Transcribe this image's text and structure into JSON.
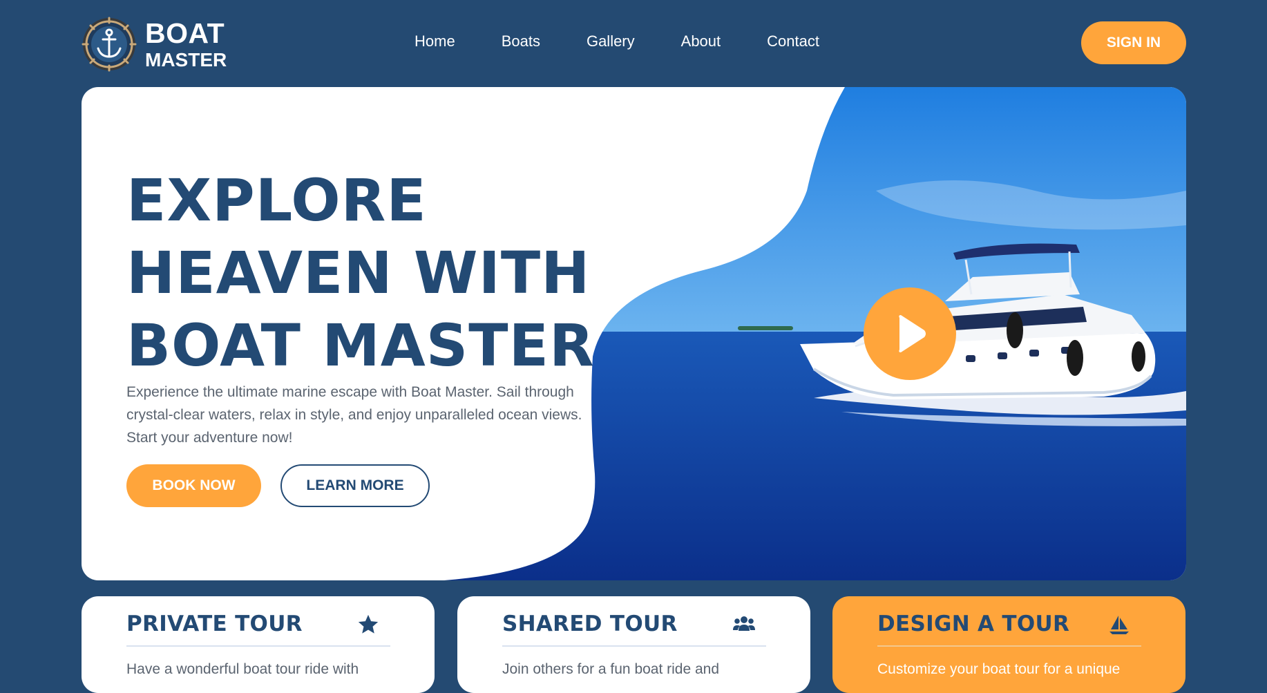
{
  "brand": {
    "name_line1": "BOAT",
    "name_line2": "MASTER",
    "logo_icon": "anchor-wheel-icon"
  },
  "nav": {
    "items": [
      {
        "label": "Home"
      },
      {
        "label": "Boats"
      },
      {
        "label": "Gallery"
      },
      {
        "label": "About"
      },
      {
        "label": "Contact"
      }
    ]
  },
  "header": {
    "signin_label": "SIGN IN"
  },
  "hero": {
    "title_lines": [
      "EXPLORE",
      "HEAVEN WITH",
      "BOAT MASTER"
    ],
    "description": "Experience the ultimate marine escape with Boat Master. Sail through crystal-clear waters, relax in style, and enjoy unparalleled ocean views. Start your adventure now!",
    "book_label": "BOOK NOW",
    "learn_label": "LEARN MORE",
    "play_icon": "play-icon"
  },
  "cards": [
    {
      "title": "PRIVATE TOUR",
      "icon": "star-icon",
      "text": "Have a wonderful boat tour ride with"
    },
    {
      "title": "SHARED TOUR",
      "icon": "users-icon",
      "text": "Join others for a fun boat ride and"
    },
    {
      "title": "DESIGN A TOUR",
      "icon": "sailboat-icon",
      "text": "Customize your boat tour for a unique"
    }
  ],
  "colors": {
    "navy": "#244a72",
    "accent": "#ffa53b",
    "text": "#234a74",
    "muted": "#5b6470"
  }
}
